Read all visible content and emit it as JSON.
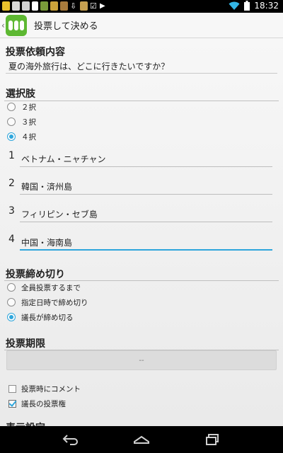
{
  "status_bar": {
    "time": "18:32",
    "notification_icons": [
      "app-icon-1",
      "app-icon-2",
      "app-icon-3",
      "sim-icon",
      "app-icon-4",
      "app-icon-5",
      "app-icon-6",
      "download-icon",
      "app-icon-7",
      "check-icon",
      "play-store-icon"
    ],
    "status_icons": [
      "wifi-icon",
      "battery-icon"
    ]
  },
  "action_bar": {
    "title": "投票して決める"
  },
  "request": {
    "section_title": "投票依頼内容",
    "value": "夏の海外旅行は、どこに行きたいですか？"
  },
  "choices": {
    "section_title": "選択肢",
    "count_options": [
      {
        "label": "２択",
        "checked": false
      },
      {
        "label": "３択",
        "checked": false
      },
      {
        "label": "４択",
        "checked": true
      }
    ],
    "items": [
      {
        "number": "1",
        "value": "ベトナム・ニャチャン"
      },
      {
        "number": "2",
        "value": "韓国・済州島"
      },
      {
        "number": "3",
        "value": "フィリピン・セブ島"
      },
      {
        "number": "4",
        "value": "中国・海南島"
      }
    ]
  },
  "deadline": {
    "section_title": "投票締め切り",
    "options": [
      {
        "label": "全員投票するまで",
        "checked": false
      },
      {
        "label": "指定日時で締め切り",
        "checked": false
      },
      {
        "label": "議長が締め切る",
        "checked": true
      }
    ]
  },
  "period": {
    "section_title": "投票期限",
    "value": "--"
  },
  "settings": {
    "checkboxes": [
      {
        "label": "投票時にコメント",
        "checked": false
      },
      {
        "label": "議長の投票権",
        "checked": true
      }
    ],
    "partial_section_title": "表示設定"
  },
  "colors": {
    "accent": "#2ea6dc",
    "app_icon": "#5db832"
  }
}
